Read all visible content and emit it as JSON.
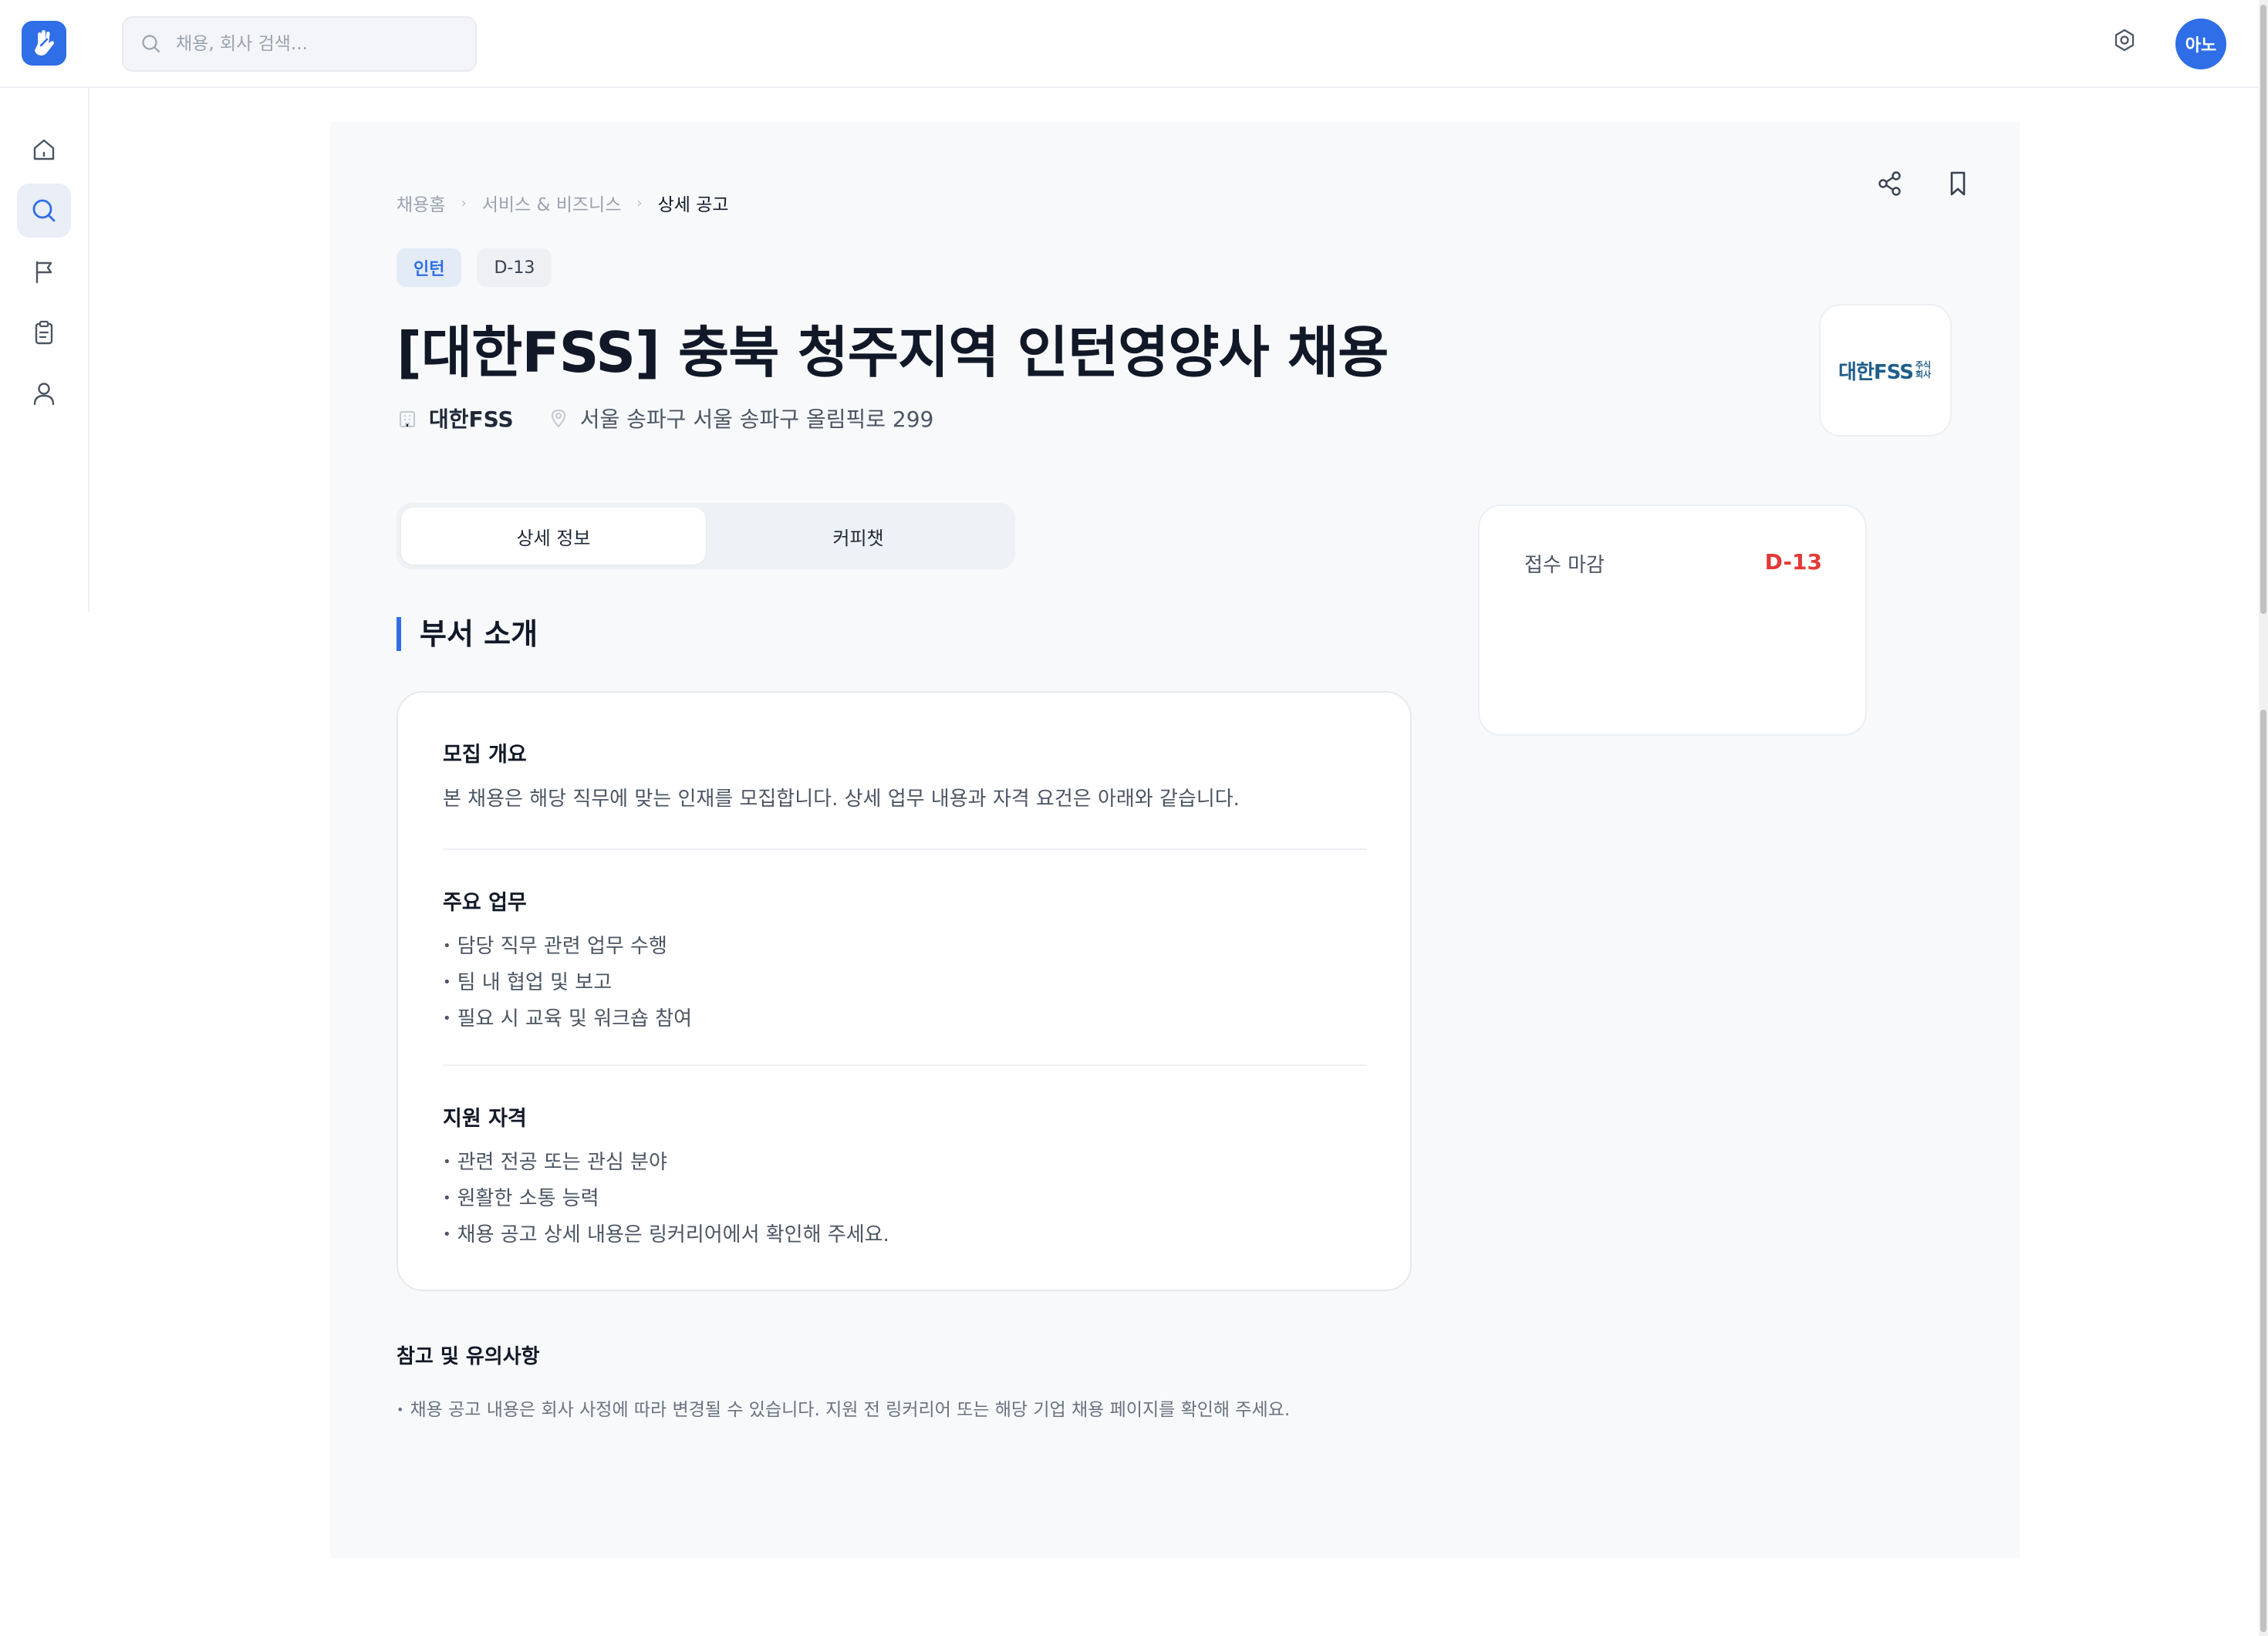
{
  "search": {
    "placeholder": "채용, 회사 검색..."
  },
  "user": {
    "avatar_text": "아노"
  },
  "colors": {
    "accent": "#2f6ee6",
    "danger": "#e53935"
  },
  "sidebar": {
    "items": [
      {
        "name": "home",
        "icon": "home-icon"
      },
      {
        "name": "search",
        "icon": "search-icon",
        "active": true
      },
      {
        "name": "flag",
        "icon": "flag-icon"
      },
      {
        "name": "clipboard",
        "icon": "clipboard-icon"
      },
      {
        "name": "profile",
        "icon": "user-icon"
      }
    ]
  },
  "breadcrumb": {
    "items": [
      "채용홈",
      "서비스 & 비즈니스"
    ],
    "current": "상세 공고"
  },
  "job": {
    "tags": [
      "인턴",
      "D-13"
    ],
    "title": "[대한FSS] 충북 청주지역 인턴영양사 채용",
    "company": "대한FSS",
    "address": "서울 송파구 서울 송파구 올림픽로 299",
    "logo_text": "대한FSS",
    "logo_sub": "주식회사"
  },
  "tabs": [
    "상세 정보",
    "커피챗"
  ],
  "deadline": {
    "label": "접수 마감",
    "value": "D-13"
  },
  "section": {
    "title": "부서 소개",
    "blocks": [
      {
        "heading": "모집 개요",
        "text": "본 채용은 해당 직무에 맞는 인재를 모집합니다. 상세 업무 내용과 자격 요건은 아래와 같습니다."
      },
      {
        "heading": "주요 업무",
        "items": [
          "담당 직무 관련 업무 수행",
          "팀 내 협업 및 보고",
          "필요 시 교육 및 워크숍 참여"
        ]
      },
      {
        "heading": "지원 자격",
        "items": [
          "관련 전공 또는 관심 분야",
          "원활한 소통 능력",
          "채용 공고 상세 내용은 링커리어에서 확인해 주세요."
        ]
      }
    ]
  },
  "notes": {
    "title": "참고 및 유의사항",
    "text": "채용 공고 내용은 회사 사정에 따라 변경될 수 있습니다. 지원 전 링커리어 또는 해당 기업 채용 페이지를 확인해 주세요."
  }
}
